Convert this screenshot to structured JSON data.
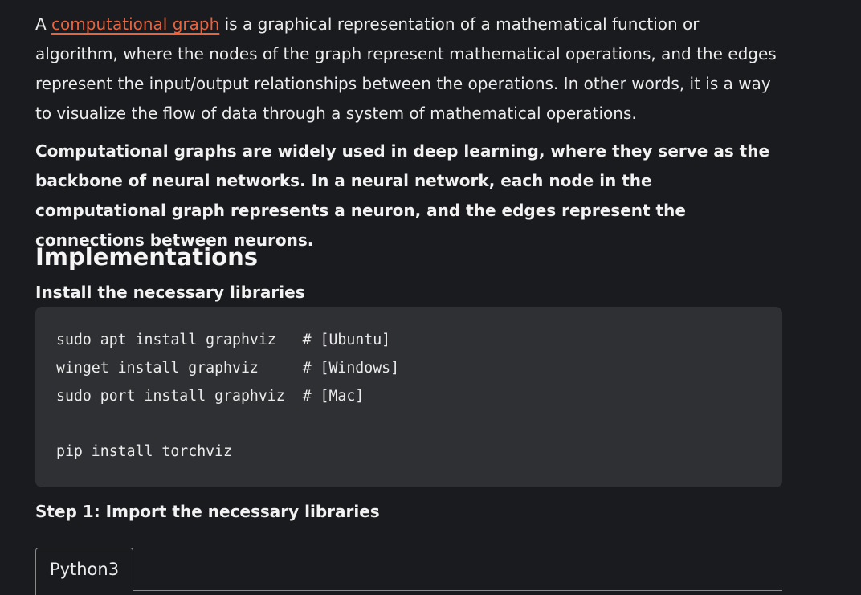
{
  "intro": {
    "article_prefix": "A",
    "link_text": "computational graph",
    "rest": "is a graphical representation of a mathematical function or algorithm, where the nodes of the graph represent mathematical operations, and the edges represent the input/output relationships between the operations. In other words, it is a way to visualize the flow of data through a system of mathematical operations."
  },
  "bold_paragraph": "Computational graphs are widely used in deep learning, where they serve as the backbone of neural networks. In a neural network, each node in the computational graph represents a neuron, and the edges represent the connections between neurons.",
  "heading": "Implementations",
  "subheading": "Install the necessary libraries",
  "code": {
    "lines": [
      "sudo apt install graphviz   # [Ubuntu]",
      "winget install graphviz     # [Windows]",
      "sudo port install graphviz  # [Mac]",
      "",
      "pip install torchviz"
    ]
  },
  "step1": "Step 1: Import  the necessary libraries",
  "code_tab": {
    "label": "Python3"
  },
  "colors": {
    "background": "#1a1b1e",
    "link": "#e8643f",
    "code_background": "#2f3033"
  }
}
